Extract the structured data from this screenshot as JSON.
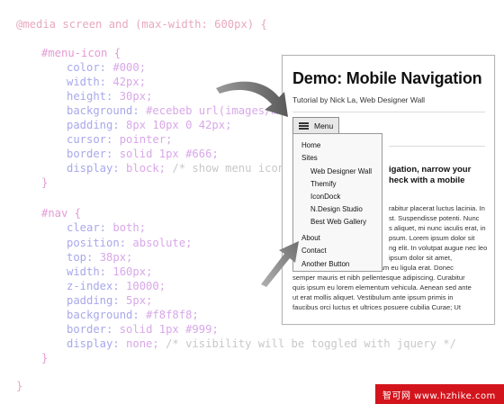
{
  "code": {
    "l1": "@media screen and (max-width: 600px) {",
    "l2": "#menu-icon {",
    "l3_prop": "color:",
    "l3_val": "#000;",
    "l4_prop": "width:",
    "l4_val": "42px;",
    "l5_prop": "height:",
    "l5_val": "30px;",
    "l6_prop": "background:",
    "l6_val": "#ecebeb url(images/menu",
    "l7_prop": "padding:",
    "l7_val": "8px 10px 0 42px;",
    "l8_prop": "cursor:",
    "l8_val": "pointer;",
    "l9_prop": "border:",
    "l9_val": "solid 1px #666;",
    "l10_prop": "display:",
    "l10_val": "block;",
    "l10_cmt": "/* show menu icon",
    "l11": "}",
    "l12": "#nav {",
    "l13_prop": "clear:",
    "l13_val": "both;",
    "l14_prop": "position:",
    "l14_val": "absolute;",
    "l15_prop": "top:",
    "l15_val": "38px;",
    "l16_prop": "width:",
    "l16_val": "160px;",
    "l17_prop": "z-index:",
    "l17_val": "10000;",
    "l18_prop": "padding:",
    "l18_val": "5px;",
    "l19_prop": "background:",
    "l19_val": "#f8f8f8;",
    "l20_prop": "border:",
    "l20_val": "solid 1px #999;",
    "l21_prop": "display:",
    "l21_val": "none;",
    "l21_cmt": "/* visibility will be toggled with jquery */",
    "l22": "}",
    "l23": "}"
  },
  "demo": {
    "title": "Demo: Mobile Navigation",
    "subtitle": "Tutorial by Nick La, Web Designer Wall",
    "menu_label": "Menu",
    "nav": {
      "home": "Home",
      "sites": "Sites",
      "wdw": "Web Designer Wall",
      "themify": "Themify",
      "icondock": "IconDock",
      "ndesign": "N.Design Studio",
      "bestweb": "Best Web Gallery",
      "about": "About",
      "contact": "Contact",
      "another": "Another Button"
    },
    "heading_l1": "igation, narrow your",
    "heading_l2": "heck with a mobile",
    "body": {
      "b1": "rabitur placerat luctus lacinia. In",
      "b2": "st. Suspendisse potenti. Nunc",
      "b3": "s aliquet, mi nunc iaculis erat, in",
      "b4": "psum. Lorem ipsum dolor sit",
      "b5": "ng elit. In volutpat augue nec leo",
      "b6": "ipsum dolor sit amet,",
      "b7": "consectetur adipiscing elit. Nam eu ligula erat. Donec",
      "b8": "semper mauris et nibh pellentesque adipiscing. Curabitur",
      "b9": "quis ipsum eu lorem elementum vehicula. Aenean sed ante",
      "b10": "ut erat mollis aliquet. Vestibulum ante ipsum primis in",
      "b11": "faucibus orci luctus et ultrices posuere cubilia Curae; Ut"
    }
  },
  "watermark": "智可网 www.hzhike.com",
  "colors": {
    "code_property": "#a8a8ec",
    "code_selector": "#e39bd6",
    "code_at_rule": "#e8a8c0",
    "code_comment": "#c8c8cc",
    "watermark_bg": "#d4141c"
  }
}
